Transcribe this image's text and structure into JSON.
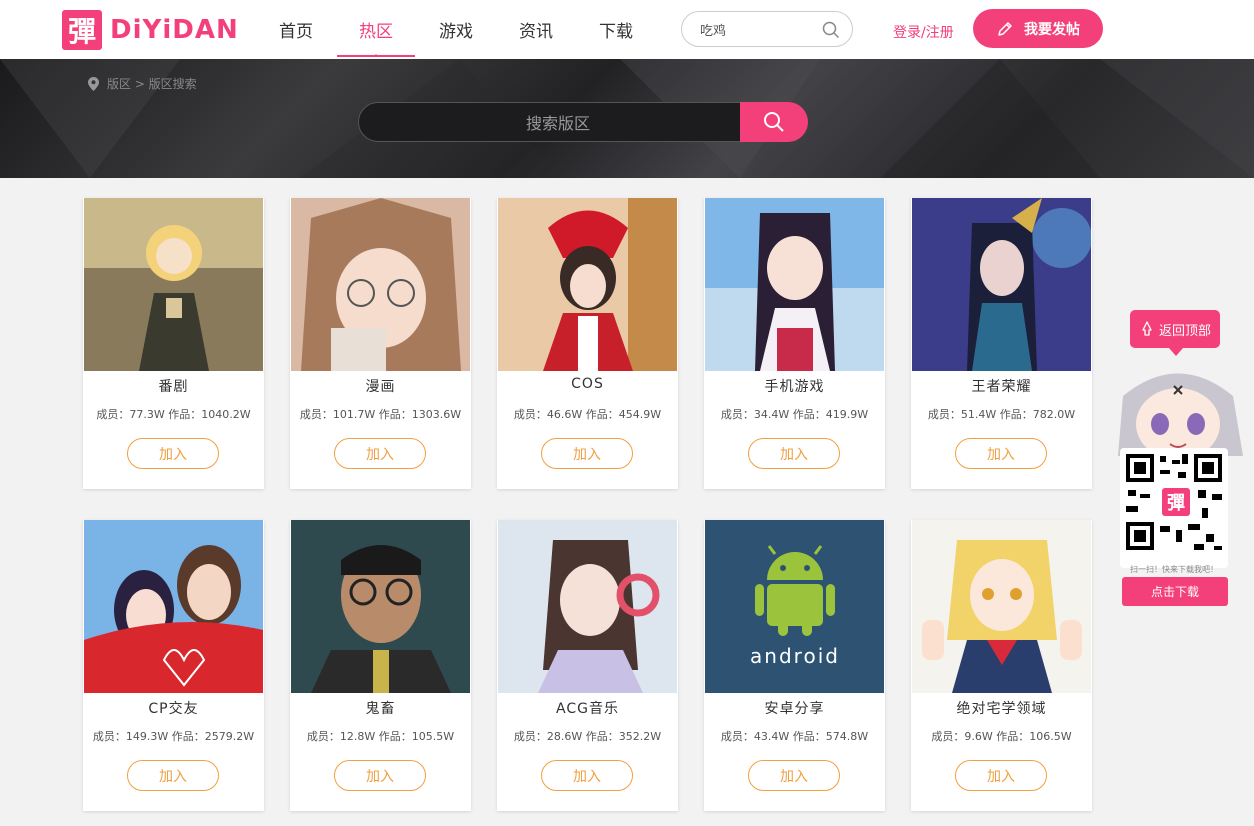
{
  "header": {
    "logo_mark": "彈",
    "logo_text": "DiYiDAN",
    "nav": [
      {
        "label": "首页",
        "active": false
      },
      {
        "label": "热区",
        "active": true
      },
      {
        "label": "游戏",
        "active": false
      },
      {
        "label": "资讯",
        "active": false
      },
      {
        "label": "下载",
        "active": false
      }
    ],
    "search_value": "吃鸡",
    "login_label": "登录/注册",
    "post_label": "我要发帖"
  },
  "banner": {
    "breadcrumb": "版区 > 版区搜索",
    "search_placeholder": "搜索版区"
  },
  "cards": [
    {
      "name": "番剧",
      "stats": "成员：77.3W    作品：1040.2W",
      "join": "加入"
    },
    {
      "name": "漫画",
      "stats": "成员：101.7W    作品：1303.6W",
      "join": "加入"
    },
    {
      "name": "COS",
      "stats": "成员：46.6W    作品：454.9W",
      "join": "加入"
    },
    {
      "name": "手机游戏",
      "stats": "成员：34.4W    作品：419.9W",
      "join": "加入"
    },
    {
      "name": "王者荣耀",
      "stats": "成员：51.4W    作品：782.0W",
      "join": "加入"
    },
    {
      "name": "CP交友",
      "stats": "成员：149.3W    作品：2579.2W",
      "join": "加入"
    },
    {
      "name": "鬼畜",
      "stats": "成员：12.8W    作品：105.5W",
      "join": "加入"
    },
    {
      "name": "ACG音乐",
      "stats": "成员：28.6W    作品：352.2W",
      "join": "加入"
    },
    {
      "name": "安卓分享",
      "stats": "成员：43.4W    作品：574.8W",
      "join": "加入"
    },
    {
      "name": "绝对宅学领域",
      "stats": "成员：9.6W    作品：106.5W",
      "join": "加入"
    }
  ],
  "side": {
    "back_top": "返回顶部",
    "qr_caption": "扫一扫！快来下载我吧！",
    "download": "点击下载",
    "qr_mark": "彈"
  },
  "android_label": "android",
  "colors": {
    "accent": "#f3407a",
    "join": "#f0a040"
  }
}
